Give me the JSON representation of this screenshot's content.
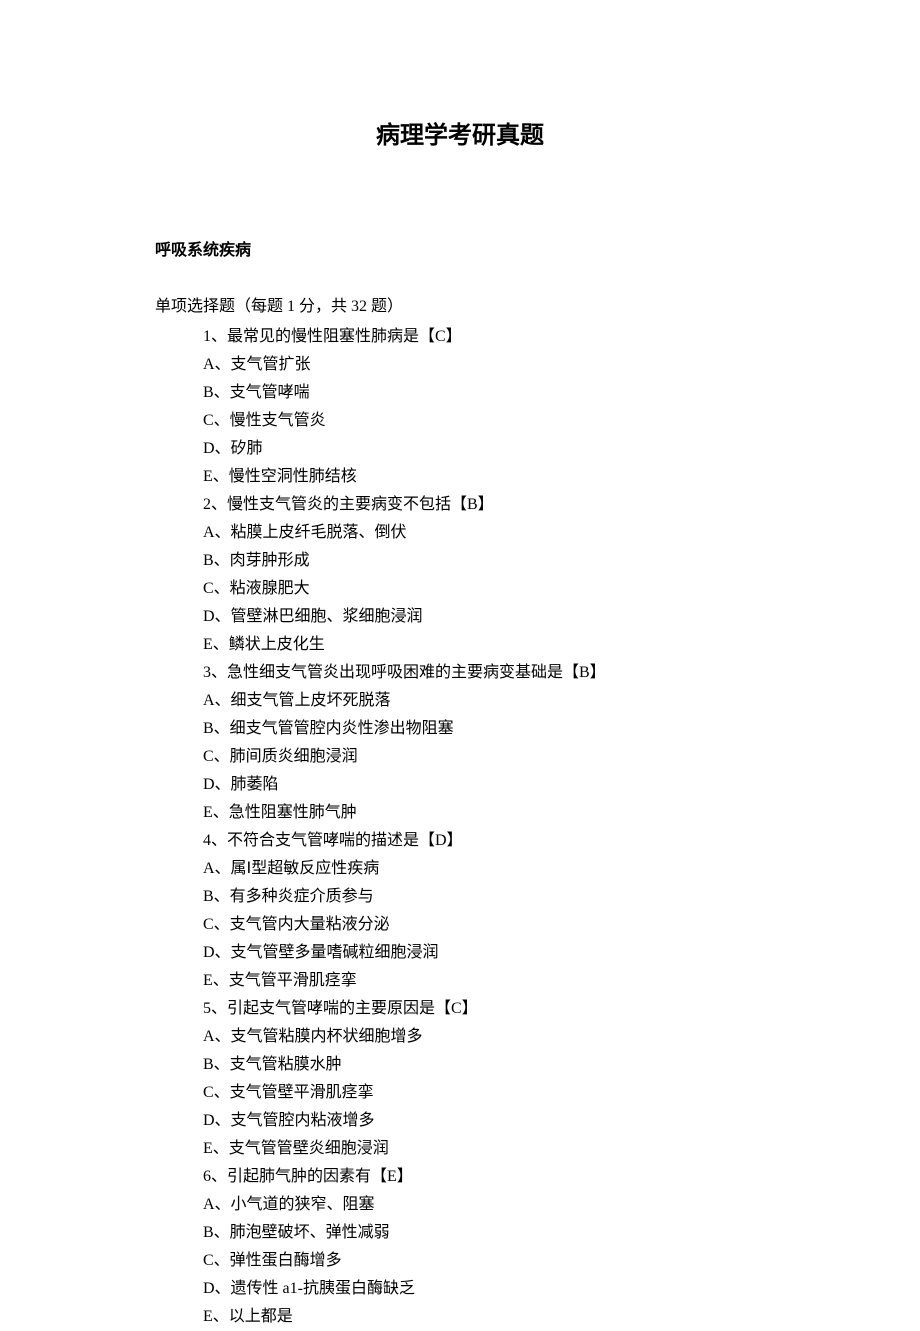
{
  "title": "病理学考研真题",
  "section": "呼吸系统疾病",
  "intro": "单项选择题（每题 1 分，共 32 题）",
  "questions": [
    {
      "stem": "1、最常见的慢性阻塞性肺病是【C】",
      "options": [
        "A、支气管扩张",
        "B、支气管哮喘",
        "C、慢性支气管炎",
        "D、矽肺",
        "E、慢性空洞性肺结核"
      ]
    },
    {
      "stem": "2、慢性支气管炎的主要病变不包括【B】",
      "options": [
        "A、粘膜上皮纤毛脱落、倒伏",
        "B、肉芽肿形成",
        "C、粘液腺肥大",
        "D、管壁淋巴细胞、浆细胞浸润",
        "E、鳞状上皮化生"
      ]
    },
    {
      "stem": "3、急性细支气管炎出现呼吸困难的主要病变基础是【B】",
      "options": [
        "A、细支气管上皮坏死脱落",
        "B、细支气管管腔内炎性渗出物阻塞",
        "C、肺间质炎细胞浸润",
        "D、肺萎陷",
        "E、急性阻塞性肺气肿"
      ]
    },
    {
      "stem": "4、不符合支气管哮喘的描述是【D】",
      "options": [
        "A、属Ⅰ型超敏反应性疾病",
        "B、有多种炎症介质参与",
        "C、支气管内大量粘液分泌",
        "D、支气管壁多量嗜碱粒细胞浸润",
        "E、支气管平滑肌痉挛"
      ]
    },
    {
      "stem": "5、引起支气管哮喘的主要原因是【C】",
      "options": [
        "A、支气管粘膜内杯状细胞增多",
        "B、支气管粘膜水肿",
        "C、支气管壁平滑肌痉挛",
        "D、支气管腔内粘液增多",
        "E、支气管管壁炎细胞浸润"
      ]
    },
    {
      "stem": "6、引起肺气肿的因素有【E】",
      "options": [
        "A、小气道的狭窄、阻塞",
        "B、肺泡壁破坏、弹性减弱",
        "C、弹性蛋白酶增多",
        "D、遗传性 a1-抗胰蛋白酶缺乏",
        "E、以上都是"
      ]
    }
  ]
}
